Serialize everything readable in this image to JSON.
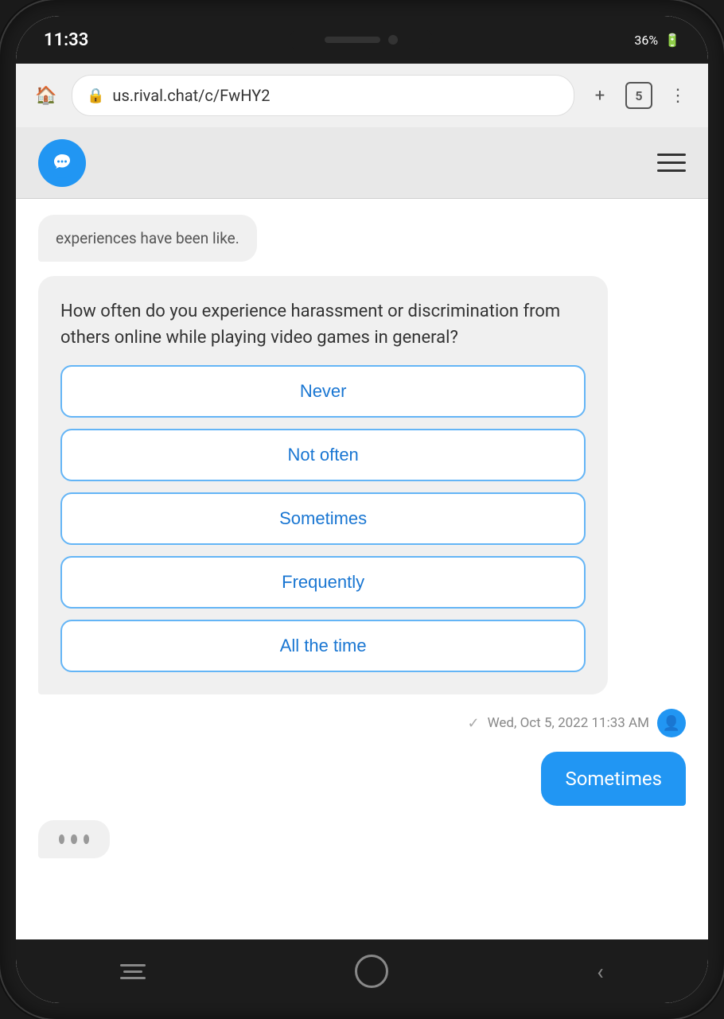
{
  "status_bar": {
    "time": "11:33",
    "battery": "36%",
    "icons_label": "status icons"
  },
  "browser": {
    "url": "us.rival.chat/c/FwHY2",
    "tab_count": "5",
    "home_icon": "🏠",
    "add_icon": "+",
    "menu_icon": "⋮",
    "lock_icon": "🔒"
  },
  "app_header": {
    "logo_alt": "Rival Chat logo",
    "menu_label": "Menu"
  },
  "chat": {
    "partial_message": "experiences have been like.",
    "question": "How often do you experience harassment or discrimination from others online while playing video games in general?",
    "options": [
      {
        "label": "Never",
        "id": "never"
      },
      {
        "label": "Not often",
        "id": "not-often"
      },
      {
        "label": "Sometimes",
        "id": "sometimes"
      },
      {
        "label": "Frequently",
        "id": "frequently"
      },
      {
        "label": "All the time",
        "id": "all-the-time"
      }
    ],
    "timestamp": "Wed, Oct 5, 2022 11:33 AM",
    "user_response": "Sometimes",
    "typing_dots": "..."
  },
  "bottom_nav": {
    "home_label": "Home",
    "circle_label": "Home button",
    "back_label": "Back"
  }
}
